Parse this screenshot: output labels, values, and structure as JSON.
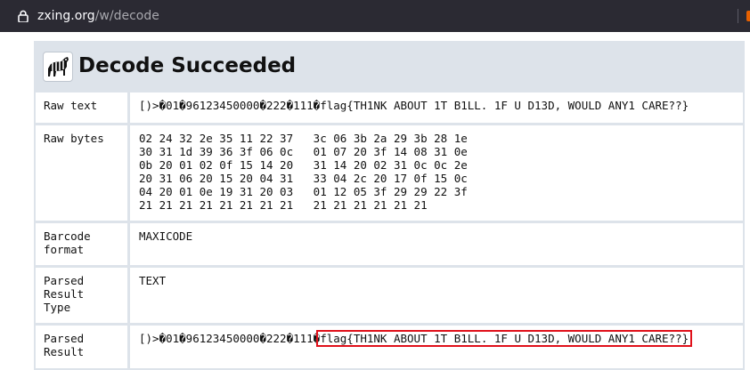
{
  "browser": {
    "url_host": "zxing.org",
    "url_path": "/w/decode"
  },
  "page": {
    "title": "Decode Succeeded"
  },
  "rows": {
    "raw_text": {
      "label": "Raw text",
      "value": "[)>�01�96123450000�222�111�flag{TH1NK ABOUT 1T B1LL. 1F U D13D, WOULD ANY1 CARE??}"
    },
    "raw_bytes": {
      "label": "Raw bytes",
      "value": "02 24 32 2e 35 11 22 37   3c 06 3b 2a 29 3b 28 1e\n30 31 1d 39 36 3f 06 0c   01 07 20 3f 14 08 31 0e\n0b 20 01 02 0f 15 14 20   31 14 20 02 31 0c 0c 2e\n20 31 06 20 15 20 04 31   33 04 2c 20 17 0f 15 0c\n04 20 01 0e 19 31 20 03   01 12 05 3f 29 29 22 3f\n21 21 21 21 21 21 21 21   21 21 21 21 21 21"
    },
    "barcode_format": {
      "label": "Barcode\nformat",
      "value": "MAXICODE"
    },
    "parsed_result_type": {
      "label": "Parsed\nResult\nType",
      "value": "TEXT"
    },
    "parsed_result": {
      "label": "Parsed\nResult",
      "prefix": "[)>�01�96123450000�222�111�",
      "highlighted": "flag{TH1NK ABOUT 1T B1LL. 1F U D13D, WOULD ANY1 CARE??}"
    }
  },
  "colors": {
    "browser_bar": "#2b2a33",
    "panel_bg": "#dde3ea",
    "highlight_border": "#e0101a"
  },
  "icons": {
    "lock": "lock-icon",
    "logo": "zebra-logo-icon",
    "extension": "extension-icon"
  }
}
